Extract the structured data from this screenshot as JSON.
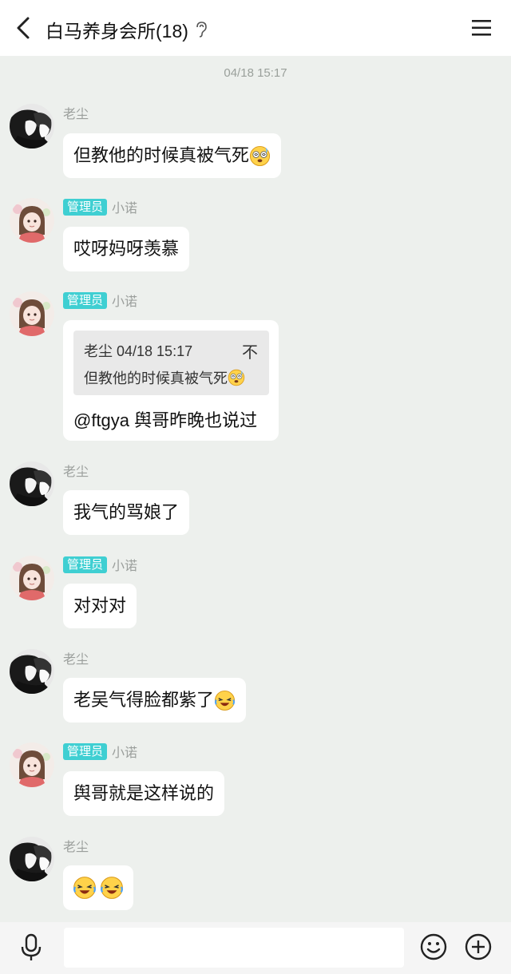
{
  "header": {
    "title": "白马养身会所(18)"
  },
  "timestamp": "04/18 15:17",
  "messages": [
    {
      "name": "老尘",
      "text": "但教他的时候真被气死"
    },
    {
      "badge": "管理员",
      "name": "小诺",
      "text": "哎呀妈呀羡慕"
    },
    {
      "badge": "管理员",
      "name": "小诺",
      "quote": {
        "header": "老尘 04/18 15:17",
        "pin": "不",
        "text": "但教他的时候真被气死"
      },
      "text": "@ftgya 舆哥昨晚也说过"
    },
    {
      "name": "老尘",
      "text": "我气的骂娘了"
    },
    {
      "badge": "管理员",
      "name": "小诺",
      "text": "对对对"
    },
    {
      "name": "老尘",
      "text": "老吴气得脸都紫了"
    },
    {
      "badge": "管理员",
      "name": "小诺",
      "text": "舆哥就是这样说的"
    },
    {
      "name": "老尘",
      "text": ""
    }
  ],
  "icons": {
    "back": "chevron-left-icon",
    "ear": "ear-icon",
    "menu": "menu-icon",
    "mic": "microphone-icon",
    "smile": "smiley-icon",
    "plus": "plus-circle-icon",
    "emoji_faint": "dizzy-face-emoji",
    "emoji_laugh": "laughing-tears-emoji"
  },
  "colors": {
    "badge": "#3fcfd2",
    "background": "#edf0ed"
  }
}
